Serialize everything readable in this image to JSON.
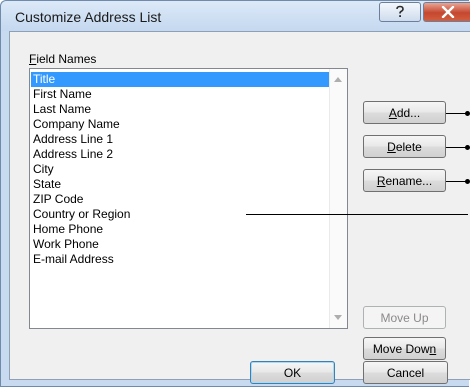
{
  "window": {
    "title": "Customize Address List",
    "help_icon_glyph": "?",
    "close_icon_glyph": "X"
  },
  "field_names": {
    "label_mnemonic": "F",
    "label_rest": "ield Names",
    "items": [
      "Title",
      "First Name",
      "Last Name",
      "Company Name",
      "Address Line 1",
      "Address Line 2",
      "City",
      "State",
      "ZIP Code",
      "Country or Region",
      "Home Phone",
      "Work Phone",
      "E-mail Address"
    ],
    "selected_index": 0
  },
  "buttons": {
    "add_mnemonic": "A",
    "add_rest": "dd...",
    "delete_mnemonic": "D",
    "delete_rest": "elete",
    "rename_mnemonic": "R",
    "rename_rest": "ename...",
    "move_up": "Move Up",
    "move_down_prefix": "Move Dow",
    "move_down_mnemonic": "n",
    "ok": "OK",
    "cancel": "Cancel"
  },
  "colors": {
    "selection": "#3399ff",
    "close_button": "#c5472f"
  }
}
